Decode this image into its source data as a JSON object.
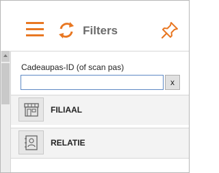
{
  "header": {
    "title": "Filters",
    "menu_icon": "hamburger-menu-icon",
    "refresh_icon": "refresh-icon",
    "pin_icon": "pin-icon",
    "accent_color": "#e87722"
  },
  "search": {
    "label": "Cadeaupas-ID (of scan pas)",
    "value": "",
    "clear_label": "x"
  },
  "filters": {
    "items": [
      {
        "label": "FILIAAL",
        "icon": "store-icon"
      },
      {
        "label": "RELATIE",
        "icon": "contact-card-icon"
      }
    ]
  }
}
